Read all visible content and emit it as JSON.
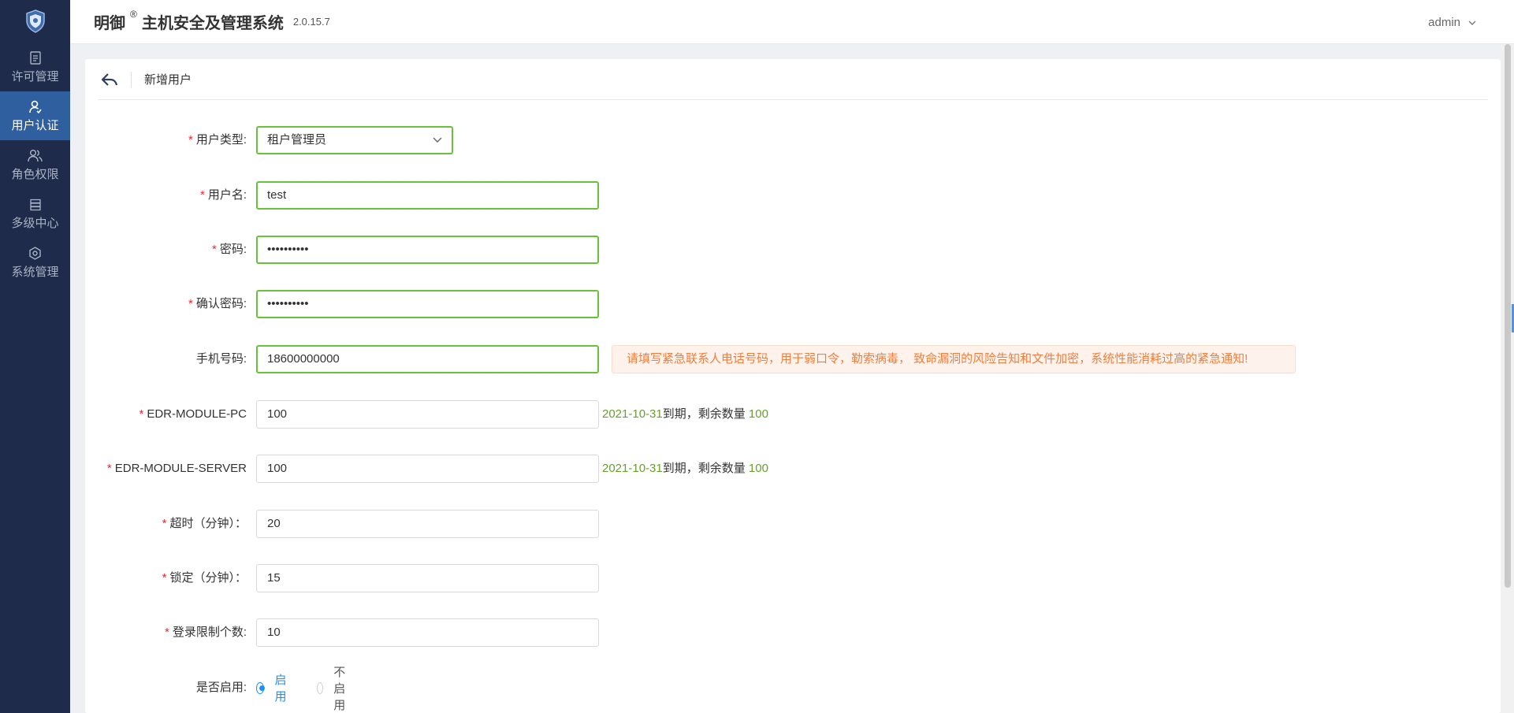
{
  "app": {
    "brand_main": "明御",
    "brand_reg": "®",
    "brand_sub": "主机安全及管理系统",
    "version": "2.0.15.7",
    "user": "admin"
  },
  "sidebar": {
    "items": [
      {
        "label": "许可管理",
        "icon": "license-icon"
      },
      {
        "label": "用户认证",
        "icon": "user-auth-icon",
        "active": true
      },
      {
        "label": "角色权限",
        "icon": "role-icon"
      },
      {
        "label": "多级中心",
        "icon": "multi-center-icon"
      },
      {
        "label": "系统管理",
        "icon": "settings-icon"
      }
    ]
  },
  "page": {
    "title": "新增用户"
  },
  "form": {
    "user_type": {
      "label": "用户类型:",
      "value": "租户管理员"
    },
    "username": {
      "label": "用户名:",
      "value": "test"
    },
    "password": {
      "label": "密码:",
      "value": "••••••••••"
    },
    "confirm_password": {
      "label": "确认密码:",
      "value": "••••••••••"
    },
    "phone": {
      "label": "手机号码:",
      "value": "18600000000",
      "tip": "请填写紧急联系人电话号码，用于弱口令，勒索病毒， 致命漏洞的风险告知和文件加密，系统性能消耗过高的紧急通知!"
    },
    "edr_pc": {
      "label": "EDR-MODULE-PC",
      "value": "100",
      "date": "2021-10-31",
      "suffix": "到期，剩余数量 ",
      "remain": "100"
    },
    "edr_server": {
      "label": "EDR-MODULE-SERVER",
      "value": "100",
      "date": "2021-10-31",
      "suffix": "到期，剩余数量 ",
      "remain": "100"
    },
    "timeout": {
      "label": "超时（分钟）：",
      "value": "20"
    },
    "lock": {
      "label": "锁定（分钟）：",
      "value": "15"
    },
    "login_limit": {
      "label": "登录限制个数:",
      "value": "10"
    },
    "enabled": {
      "label": "是否启用:",
      "on": "启用",
      "off": "不启用",
      "selected": "on"
    }
  },
  "colors": {
    "sidebar": "#1e2b4a",
    "active": "#2f5f9e",
    "valid": "#67c23a",
    "required": "#f5222d",
    "primary": "#1890ff",
    "warn": "#f07e3c"
  }
}
